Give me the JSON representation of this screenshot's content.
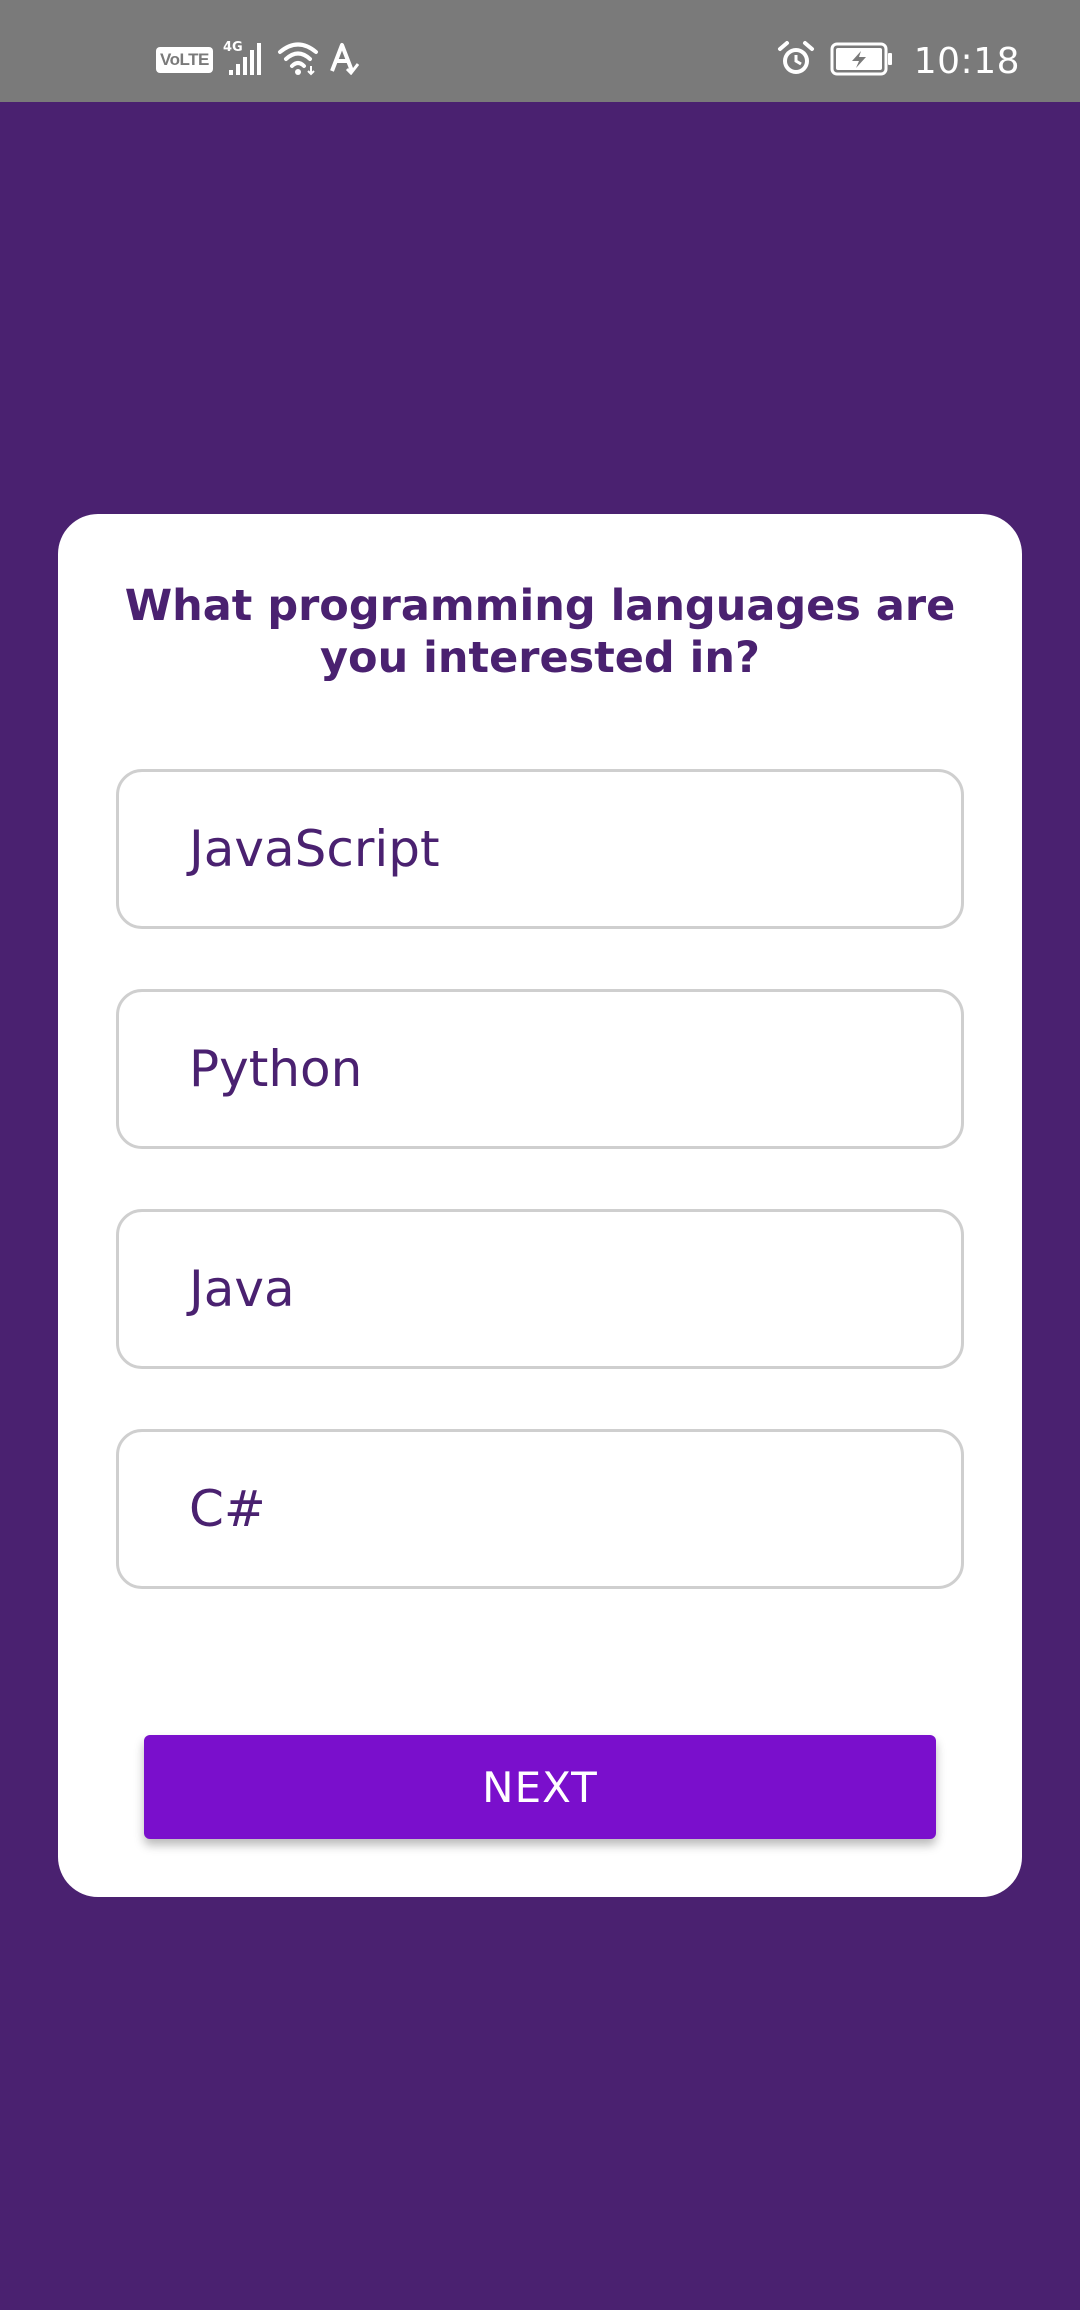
{
  "status_bar": {
    "volte": "VoLTE",
    "network": "4G",
    "time": "10:18"
  },
  "quiz": {
    "question": "What programming languages are you interested in?",
    "options": [
      {
        "label": "JavaScript"
      },
      {
        "label": "Python"
      },
      {
        "label": "Java"
      },
      {
        "label": "C#"
      }
    ],
    "next_label": "NEXT"
  },
  "colors": {
    "background": "#4a2170",
    "card": "#ffffff",
    "accent_button": "#7a0fcc",
    "text_primary": "#4a2170",
    "option_border": "#cfcfcf",
    "status_bar": "#7a7a7a"
  }
}
